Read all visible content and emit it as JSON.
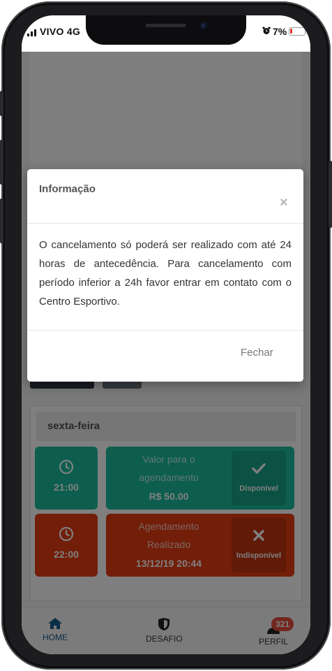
{
  "status_bar": {
    "carrier": "VIVO",
    "network": "4G",
    "battery_percent": "7%"
  },
  "schedule": {
    "date": "13/12/2019",
    "day_label": "sexta-feira",
    "slots": [
      {
        "time": "21:00",
        "line1": "Valor para o",
        "line2": "agendamento",
        "line3": "R$ 50.00",
        "status": "Disponível",
        "status_color": "#1abc9c"
      },
      {
        "time": "22:00",
        "line1": "Agendamento",
        "line2": "Realizado",
        "line3": "13/12/19 20:44",
        "status": "Indisponível",
        "status_color": "#e43d12"
      }
    ]
  },
  "bottom_nav": {
    "items": [
      {
        "label": "HOME",
        "icon": "home-icon"
      },
      {
        "label": "DESAFIO",
        "icon": "shield-icon"
      },
      {
        "label": "PERFIL",
        "icon": "user-icon"
      }
    ],
    "perfil_badge": "321"
  },
  "modal": {
    "title": "Informação",
    "close_symbol": "×",
    "body": "O cancelamento só poderá ser realizado com até 24 horas de antecedência. Para cancelamento com período inferior a 24h favor entrar em contato com o Centro Esportivo.",
    "footer_button": "Fechar"
  },
  "colors": {
    "accent_green": "#1abc9c",
    "accent_red": "#e43d12",
    "nav_active": "#1a5d8f",
    "badge": "#e74c3c"
  }
}
